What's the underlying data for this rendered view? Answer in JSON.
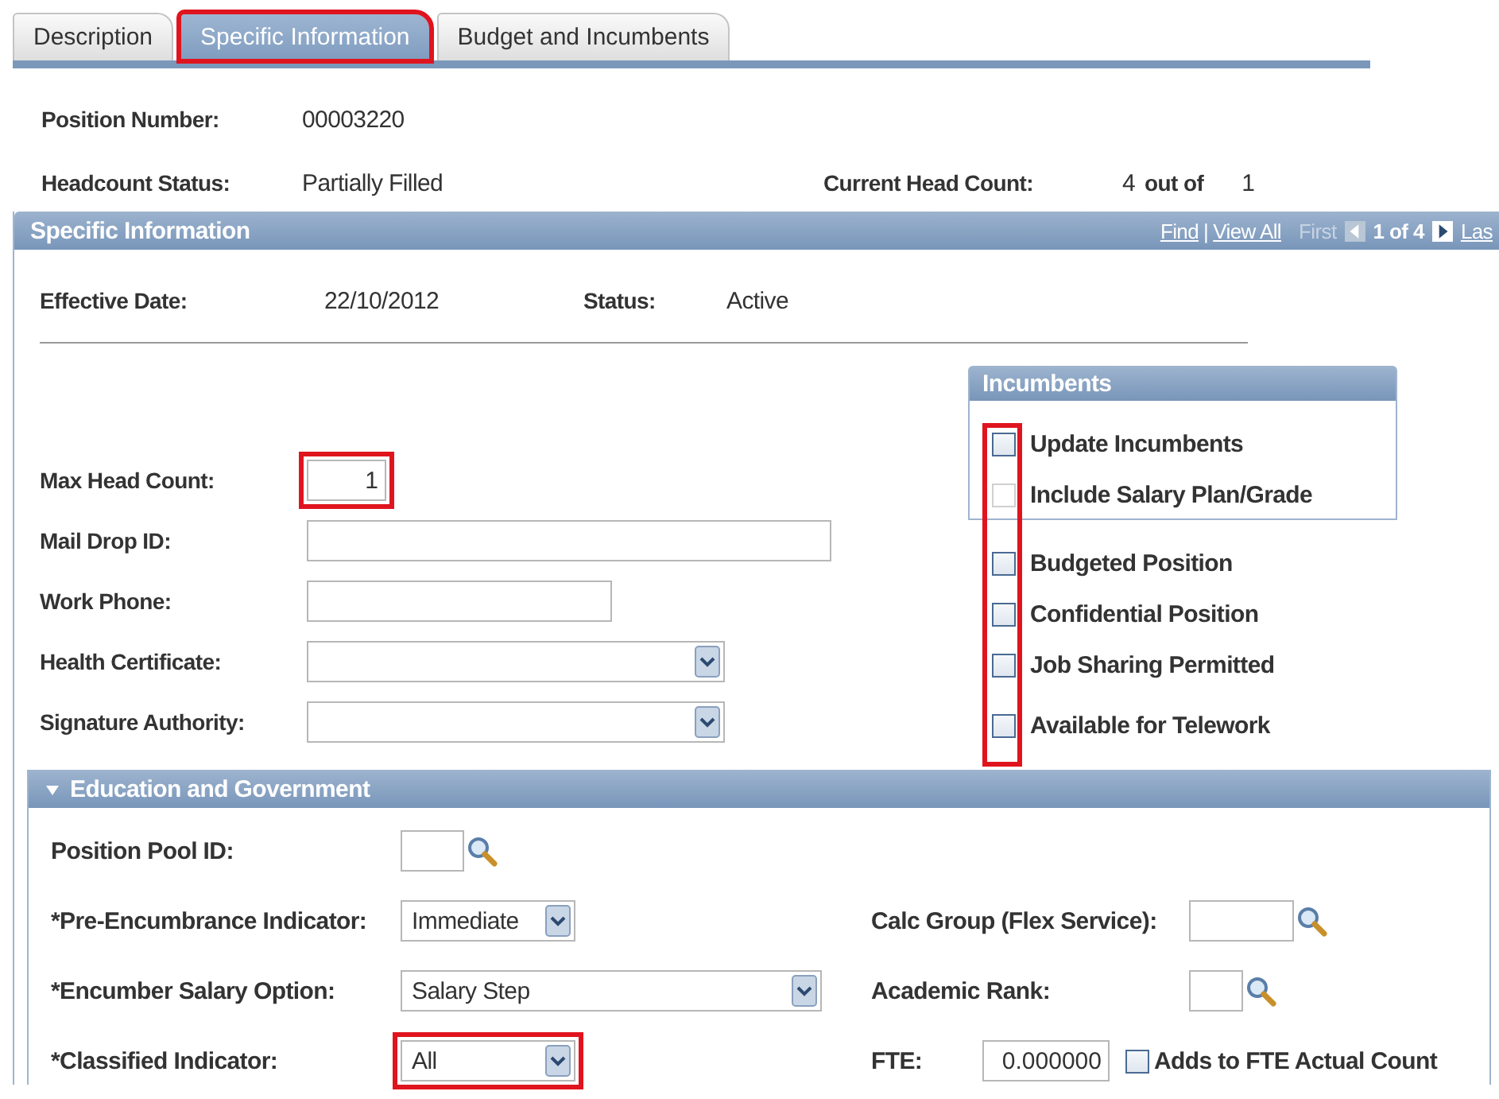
{
  "tabs": [
    {
      "label": "Description",
      "selected": false,
      "highlighted": false
    },
    {
      "label": "Specific Information",
      "selected": true,
      "highlighted": true
    },
    {
      "label": "Budget and Incumbents",
      "selected": false,
      "highlighted": false
    }
  ],
  "position_number": {
    "label": "Position Number:",
    "value": "00003220"
  },
  "headcount_status": {
    "label": "Headcount Status:",
    "value": "Partially Filled"
  },
  "current_head_count": {
    "label": "Current Head Count:",
    "value": "4",
    "out_of": "out of",
    "max": "1"
  },
  "section": {
    "title": "Specific Information",
    "find": "Find",
    "separator": "|",
    "view_all": "View All",
    "first": "First",
    "range": "1 of 4",
    "last": "Las"
  },
  "effective_date": {
    "label": "Effective Date:",
    "value": "22/10/2012"
  },
  "status": {
    "label": "Status:",
    "value": "Active"
  },
  "fields": [
    {
      "kind": "text",
      "label": "Max Head Count:",
      "value": "1",
      "highlighted": true
    },
    {
      "kind": "text",
      "label": "Mail Drop ID:",
      "highlighted": false
    },
    {
      "kind": "text",
      "label": "Work Phone:",
      "highlighted": false
    },
    {
      "kind": "select",
      "label": "Health Certificate:",
      "highlighted": false
    },
    {
      "kind": "select",
      "label": "Signature Authority:",
      "highlighted": false
    }
  ],
  "incumbents": {
    "title": "Incumbents",
    "options": [
      {
        "label": "Update Incumbents",
        "checked": false,
        "disabled": false
      },
      {
        "label": "Include Salary Plan/Grade",
        "checked": false,
        "disabled": true
      }
    ]
  },
  "checkboxes": [
    {
      "label": "Budgeted Position",
      "checked": false
    },
    {
      "label": "Confidential Position",
      "checked": false
    },
    {
      "label": "Job Sharing Permitted",
      "checked": false
    },
    {
      "label": "Available for Telework",
      "checked": false
    }
  ],
  "checkbox_highlight": true,
  "education": {
    "title": "Education and Government",
    "expanded": true,
    "rows": [
      {
        "left": {
          "kind": "lookup",
          "label": "Position Pool ID:",
          "highlighted": false
        }
      },
      {
        "left": {
          "kind": "select",
          "label": "*Pre-Encumbrance Indicator:",
          "value": "Immediate",
          "highlighted": false
        },
        "right": {
          "kind": "lookup",
          "label": "Calc Group (Flex Service):",
          "highlighted": false
        }
      },
      {
        "left": {
          "kind": "select",
          "label": "*Encumber Salary Option:",
          "value": "Salary Step",
          "highlighted": false
        },
        "right": {
          "kind": "lookup",
          "label": "Academic Rank:",
          "highlighted": false
        }
      },
      {
        "left": {
          "kind": "select",
          "label": "*Classified Indicator:",
          "value": "All",
          "highlighted": true
        },
        "right": {
          "kind": "text",
          "label": "FTE:",
          "value": "0.000000",
          "highlighted": false,
          "checkbox": {
            "label": "Adds to FTE Actual Count",
            "checked": false
          }
        }
      }
    ]
  }
}
